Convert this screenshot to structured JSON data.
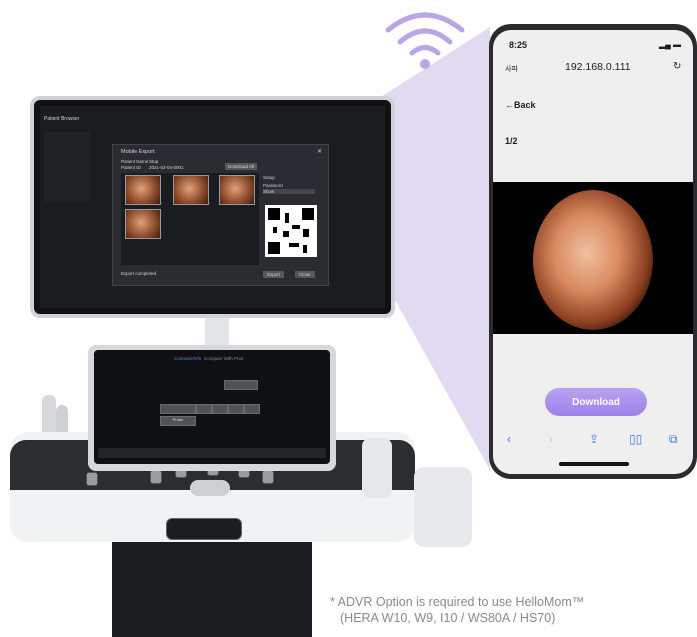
{
  "monitor": {
    "title": "Mobile Export",
    "patient_name_label": "Patient Name",
    "patient_name_value": "Stop",
    "patient_id_label": "Patient ID",
    "patient_id_value": "2021-02-04-0001",
    "export_button": "Download All",
    "option_label_1": "Setup",
    "option_label_2": "Password",
    "option_value_2": "Show",
    "status_text": "Export completed",
    "bottom_button_1": "Export",
    "bottom_button_2": "Close",
    "side_title": "Patient Browser"
  },
  "touchscreen": {
    "tab_1": "Compare/Info",
    "tab_2": "Compare With Prior",
    "center_button": "Probe"
  },
  "phone": {
    "time": "8:25",
    "left_status": "사파",
    "url": "192.168.0.111",
    "back_label": "←Back",
    "page_counter": "1/2",
    "download_label": "Download"
  },
  "footnote": {
    "line1": "* ADVR Option is required to use HelloMom™",
    "line2": "(HERA W10, W9, I10 / WS80A / HS70)"
  },
  "colors": {
    "accent": "#9b82ea",
    "beam": "#d9cfee",
    "wifi": "#b8a6e6",
    "ios_blue": "#3478f6"
  }
}
